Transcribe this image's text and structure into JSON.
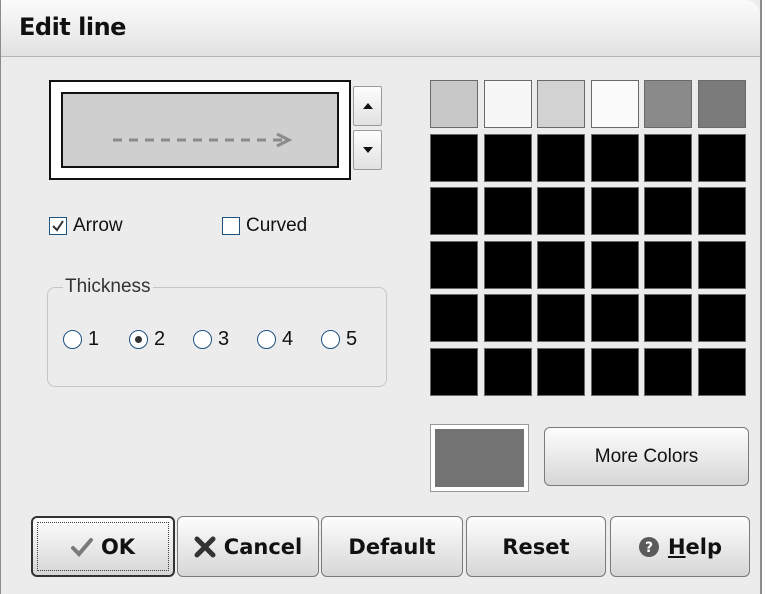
{
  "dialog": {
    "title": "Edit line"
  },
  "preview": {
    "style": "dashed-arrow",
    "line_color": "#8a8a8a",
    "background": "#cfcfcf"
  },
  "options": {
    "arrow": {
      "label": "Arrow",
      "checked": true
    },
    "curved": {
      "label": "Curved",
      "checked": false
    }
  },
  "thickness": {
    "legend": "Thickness",
    "options": [
      "1",
      "2",
      "3",
      "4",
      "5"
    ],
    "selected": "2"
  },
  "palette": {
    "colors": [
      [
        "#c8c8c8",
        "#f7f7f7",
        "#d2d2d2",
        "#fafafa",
        "#8a8a8a",
        "#7b7b7b"
      ],
      [
        "#000000",
        "#000000",
        "#000000",
        "#000000",
        "#000000",
        "#000000"
      ],
      [
        "#000000",
        "#000000",
        "#000000",
        "#000000",
        "#000000",
        "#000000"
      ],
      [
        "#000000",
        "#000000",
        "#000000",
        "#000000",
        "#000000",
        "#000000"
      ],
      [
        "#000000",
        "#000000",
        "#000000",
        "#000000",
        "#000000",
        "#000000"
      ],
      [
        "#000000",
        "#000000",
        "#000000",
        "#000000",
        "#000000",
        "#000000"
      ]
    ],
    "current_color": "#737373",
    "more_label": "More Colors"
  },
  "buttons": {
    "ok": "OK",
    "cancel": "Cancel",
    "default": "Default",
    "reset": "Reset",
    "help_h": "H",
    "help_rest": "elp"
  }
}
